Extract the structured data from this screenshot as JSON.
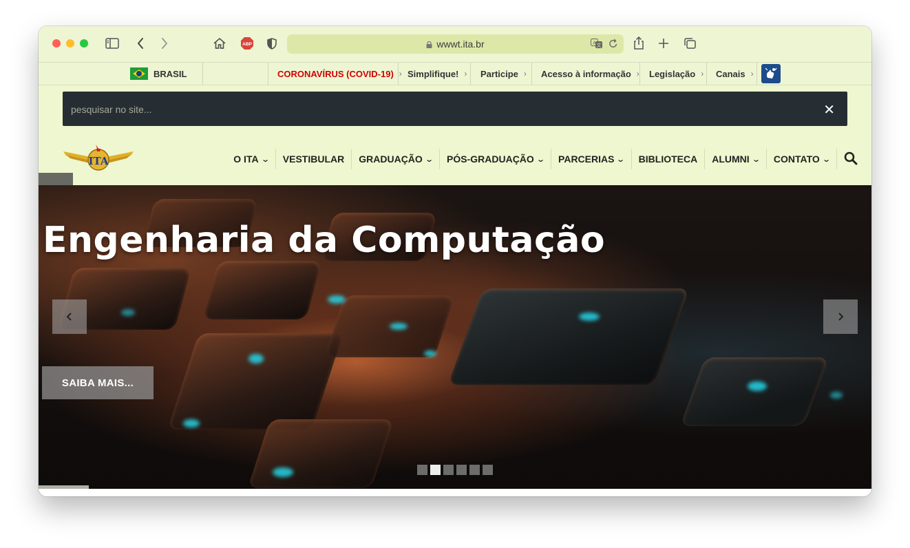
{
  "browser": {
    "url": "wwwt.ita.br"
  },
  "gov_bar": {
    "country": "BRASIL",
    "links": [
      {
        "label": "CORONAVÍRUS (COVID-19)",
        "color": "#d10000"
      },
      {
        "label": "Simplifique!"
      },
      {
        "label": "Participe"
      },
      {
        "label": "Acesso à informação"
      },
      {
        "label": "Legislação"
      },
      {
        "label": "Canais"
      }
    ]
  },
  "search": {
    "placeholder": "pesquisar no site..."
  },
  "nav": {
    "items": [
      {
        "label": "O ITA",
        "dropdown": true
      },
      {
        "label": "VESTIBULAR",
        "dropdown": false
      },
      {
        "label": "GRADUAÇÃO",
        "dropdown": true
      },
      {
        "label": "PÓS-GRADUAÇÃO",
        "dropdown": true
      },
      {
        "label": "PARCERIAS",
        "dropdown": true
      },
      {
        "label": "BIBLIOTECA",
        "dropdown": false
      },
      {
        "label": "ALUMNI",
        "dropdown": true
      },
      {
        "label": "CONTATO",
        "dropdown": true
      }
    ]
  },
  "hero": {
    "title": "Engenharia da Computação",
    "button_label": "SAIBA MAIS...",
    "slide_count": 6,
    "active_slide": 2
  },
  "colors": {
    "page_bg": "#eef7cf",
    "search_bg": "#262e33",
    "covid_red": "#d10000"
  }
}
